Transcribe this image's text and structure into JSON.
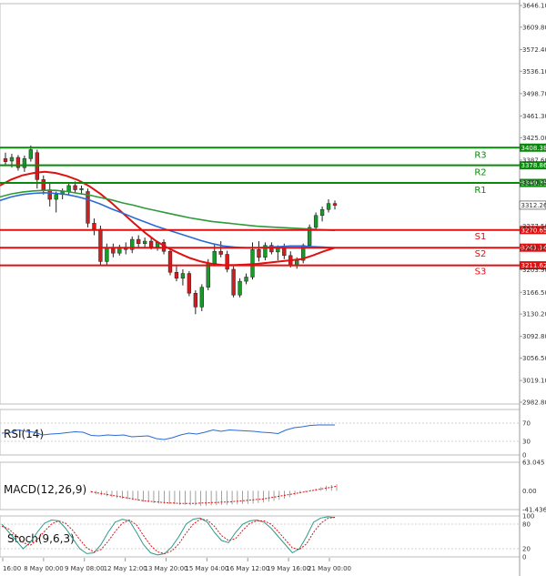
{
  "chart_data": {
    "type": "candlestick",
    "price_axis": {
      "ticks": [
        "3646.10",
        "3609.80",
        "3572.40",
        "3536.10",
        "3498.70",
        "3461.30",
        "3425.00",
        "3387.60",
        "3350.25",
        "3312.26",
        "3277.50",
        "3241.14",
        "3203.90",
        "3166.50",
        "3130.20",
        "3092.80",
        "3056.50",
        "3019.10",
        "2982.80"
      ],
      "ylim": [
        2982.8,
        3646.1
      ]
    },
    "time_axis": {
      "labels": [
        "16:00",
        "8 May 00:00",
        "9 May 08:00",
        "12 May 12:00",
        "13 May 20:00",
        "15 May 04:00",
        "16 May 12:00",
        "19 May 16:00",
        "21 May 00:00"
      ]
    },
    "current_price": "3312.26",
    "levels": [
      {
        "name": "R3",
        "value": 3408.38,
        "label": "3408.38",
        "color": "#0a8a0a"
      },
      {
        "name": "R2",
        "value": 3378.86,
        "label": "3378.86",
        "color": "#0a8a0a"
      },
      {
        "name": "R1",
        "value": 3349.35,
        "label": "3349.35",
        "color": "#0a8a0a"
      },
      {
        "name": "S1",
        "value": 3270.65,
        "label": "3270.65",
        "color": "#e01010"
      },
      {
        "name": "S2",
        "value": 3241.14,
        "label": "3241.14",
        "color": "#e01010"
      },
      {
        "name": "S3",
        "value": 3211.62,
        "label": "3211.62",
        "color": "#e01010"
      }
    ],
    "candles": [
      {
        "o": 3390,
        "h": 3400,
        "l": 3380,
        "c": 3385
      },
      {
        "o": 3386,
        "h": 3398,
        "l": 3375,
        "c": 3392
      },
      {
        "o": 3392,
        "h": 3396,
        "l": 3370,
        "c": 3375
      },
      {
        "o": 3375,
        "h": 3395,
        "l": 3368,
        "c": 3390
      },
      {
        "o": 3390,
        "h": 3412,
        "l": 3385,
        "c": 3405
      },
      {
        "o": 3400,
        "h": 3405,
        "l": 3340,
        "c": 3355
      },
      {
        "o": 3355,
        "h": 3362,
        "l": 3330,
        "c": 3338
      },
      {
        "o": 3338,
        "h": 3350,
        "l": 3310,
        "c": 3322
      },
      {
        "o": 3322,
        "h": 3335,
        "l": 3300,
        "c": 3330
      },
      {
        "o": 3330,
        "h": 3340,
        "l": 3322,
        "c": 3335
      },
      {
        "o": 3335,
        "h": 3350,
        "l": 3328,
        "c": 3345
      },
      {
        "o": 3345,
        "h": 3352,
        "l": 3332,
        "c": 3338
      },
      {
        "o": 3338,
        "h": 3345,
        "l": 3330,
        "c": 3340
      },
      {
        "o": 3335,
        "h": 3340,
        "l": 3275,
        "c": 3282
      },
      {
        "o": 3282,
        "h": 3290,
        "l": 3262,
        "c": 3272
      },
      {
        "o": 3272,
        "h": 3278,
        "l": 3212,
        "c": 3218
      },
      {
        "o": 3218,
        "h": 3248,
        "l": 3212,
        "c": 3240
      },
      {
        "o": 3240,
        "h": 3248,
        "l": 3225,
        "c": 3232
      },
      {
        "o": 3232,
        "h": 3246,
        "l": 3228,
        "c": 3242
      },
      {
        "o": 3242,
        "h": 3250,
        "l": 3230,
        "c": 3238
      },
      {
        "o": 3238,
        "h": 3260,
        "l": 3232,
        "c": 3255
      },
      {
        "o": 3255,
        "h": 3262,
        "l": 3240,
        "c": 3248
      },
      {
        "o": 3248,
        "h": 3258,
        "l": 3240,
        "c": 3252
      },
      {
        "o": 3252,
        "h": 3258,
        "l": 3238,
        "c": 3242
      },
      {
        "o": 3242,
        "h": 3252,
        "l": 3236,
        "c": 3250
      },
      {
        "o": 3250,
        "h": 3255,
        "l": 3230,
        "c": 3235
      },
      {
        "o": 3235,
        "h": 3240,
        "l": 3195,
        "c": 3200
      },
      {
        "o": 3200,
        "h": 3212,
        "l": 3185,
        "c": 3190
      },
      {
        "o": 3190,
        "h": 3205,
        "l": 3178,
        "c": 3198
      },
      {
        "o": 3198,
        "h": 3202,
        "l": 3160,
        "c": 3165
      },
      {
        "o": 3165,
        "h": 3170,
        "l": 3130,
        "c": 3142
      },
      {
        "o": 3142,
        "h": 3180,
        "l": 3135,
        "c": 3175
      },
      {
        "o": 3175,
        "h": 3222,
        "l": 3170,
        "c": 3215
      },
      {
        "o": 3215,
        "h": 3248,
        "l": 3210,
        "c": 3235
      },
      {
        "o": 3235,
        "h": 3252,
        "l": 3225,
        "c": 3230
      },
      {
        "o": 3230,
        "h": 3236,
        "l": 3200,
        "c": 3205
      },
      {
        "o": 3205,
        "h": 3210,
        "l": 3158,
        "c": 3162
      },
      {
        "o": 3162,
        "h": 3190,
        "l": 3158,
        "c": 3185
      },
      {
        "o": 3185,
        "h": 3198,
        "l": 3180,
        "c": 3192
      },
      {
        "o": 3192,
        "h": 3250,
        "l": 3188,
        "c": 3238
      },
      {
        "o": 3238,
        "h": 3252,
        "l": 3218,
        "c": 3225
      },
      {
        "o": 3225,
        "h": 3250,
        "l": 3220,
        "c": 3245
      },
      {
        "o": 3245,
        "h": 3250,
        "l": 3230,
        "c": 3234
      },
      {
        "o": 3234,
        "h": 3245,
        "l": 3220,
        "c": 3240
      },
      {
        "o": 3240,
        "h": 3248,
        "l": 3222,
        "c": 3228
      },
      {
        "o": 3228,
        "h": 3235,
        "l": 3208,
        "c": 3212
      },
      {
        "o": 3212,
        "h": 3225,
        "l": 3206,
        "c": 3220
      },
      {
        "o": 3220,
        "h": 3248,
        "l": 3215,
        "c": 3245
      },
      {
        "o": 3245,
        "h": 3280,
        "l": 3240,
        "c": 3275
      },
      {
        "o": 3275,
        "h": 3300,
        "l": 3270,
        "c": 3295
      },
      {
        "o": 3295,
        "h": 3310,
        "l": 3285,
        "c": 3305
      },
      {
        "o": 3305,
        "h": 3322,
        "l": 3300,
        "c": 3315
      },
      {
        "o": 3315,
        "h": 3320,
        "l": 3305,
        "c": 3312
      }
    ],
    "overlays": [
      {
        "name": "sma_fast",
        "color": "#e01010",
        "values": [
          3345,
          3355,
          3362,
          3366,
          3368,
          3366,
          3361,
          3354,
          3344,
          3331,
          3316,
          3299,
          3282,
          3266,
          3252,
          3241,
          3232,
          3224,
          3218,
          3214,
          3212,
          3212,
          3213,
          3214,
          3216,
          3218,
          3220,
          3222,
          3228,
          3235,
          3241
        ]
      },
      {
        "name": "sma_mid",
        "color": "#2b6ad6",
        "values": [
          3320,
          3326,
          3330,
          3332,
          3333,
          3332,
          3330,
          3326,
          3321,
          3314,
          3306,
          3299,
          3291,
          3284,
          3277,
          3271,
          3265,
          3259,
          3253,
          3248,
          3244,
          3242,
          3241,
          3241,
          3242,
          3243,
          3244,
          3244,
          3243,
          3242,
          3241
        ]
      },
      {
        "name": "sma_slow",
        "color": "#2e9a3a",
        "values": [
          3326,
          3331,
          3334,
          3336,
          3337,
          3337,
          3335,
          3332,
          3329,
          3325,
          3321,
          3316,
          3312,
          3307,
          3303,
          3299,
          3295,
          3291,
          3288,
          3285,
          3283,
          3281,
          3279,
          3277,
          3276,
          3275,
          3274,
          3273,
          3272,
          3271,
          3270
        ]
      }
    ],
    "rsi": {
      "label": "RSI(14)",
      "ticks": [
        "70",
        "30",
        "0"
      ],
      "ylim": [
        0,
        100
      ],
      "color": "#2b6ad6",
      "values": [
        48,
        49,
        55,
        52,
        50,
        44,
        46,
        47,
        49,
        51,
        50,
        43,
        42,
        44,
        43,
        44,
        40,
        41,
        42,
        36,
        34,
        38,
        44,
        48,
        46,
        50,
        55,
        52,
        55,
        54,
        53,
        52,
        50,
        49,
        47,
        55,
        60,
        62,
        65,
        66,
        66,
        66
      ]
    },
    "macd": {
      "label": "MACD(12,26,9)",
      "ticks": [
        "63.045",
        "0.00",
        "-41.436"
      ],
      "ylim": [
        -41.436,
        63.045
      ],
      "signal_color": "#e01010",
      "hist_color": "#888888",
      "histogram": [
        -4,
        -8,
        -10,
        -12,
        -14,
        -16,
        -17,
        -18,
        -20,
        -22,
        -24,
        -25,
        -27,
        -28,
        -28,
        -29,
        -30,
        -31,
        -31,
        -32,
        -32,
        -33,
        -33,
        -32,
        -32,
        -31,
        -31,
        -30,
        -30,
        -29,
        -29,
        -28,
        -27,
        -26,
        -24,
        -22,
        -20,
        -17,
        -14,
        -10,
        -6,
        -2,
        2,
        5,
        8,
        11,
        13,
        14
      ],
      "signal": [
        -2,
        -4,
        -6,
        -8,
        -10,
        -12,
        -14,
        -16,
        -18,
        -20,
        -22,
        -23,
        -24,
        -25,
        -26,
        -27,
        -27,
        -28,
        -28,
        -28,
        -28,
        -27,
        -27,
        -26,
        -26,
        -25,
        -25,
        -24,
        -23,
        -22,
        -21,
        -20,
        -19,
        -18,
        -16,
        -14,
        -12,
        -10,
        -8,
        -6,
        -4,
        -2,
        0,
        2,
        4,
        6,
        8,
        10
      ]
    },
    "stoch": {
      "label": "Stoch(9,6,3)",
      "ticks": [
        "100",
        "80",
        "20",
        "0"
      ],
      "ylim": [
        0,
        100
      ],
      "k_color": "#2e9a8a",
      "d_color": "#e01010",
      "k": [
        80,
        60,
        40,
        20,
        35,
        60,
        82,
        90,
        88,
        70,
        45,
        20,
        8,
        10,
        30,
        60,
        85,
        92,
        88,
        60,
        30,
        10,
        5,
        8,
        25,
        50,
        80,
        92,
        95,
        85,
        60,
        40,
        35,
        60,
        80,
        88,
        90,
        85,
        70,
        50,
        30,
        10,
        20,
        50,
        85,
        95,
        98,
        96
      ],
      "d": [
        75,
        68,
        52,
        35,
        28,
        42,
        62,
        80,
        88,
        82,
        65,
        42,
        22,
        12,
        18,
        38,
        62,
        82,
        90,
        78,
        52,
        28,
        12,
        8,
        15,
        32,
        58,
        80,
        92,
        90,
        75,
        52,
        40,
        45,
        65,
        82,
        88,
        88,
        80,
        62,
        42,
        22,
        18,
        32,
        60,
        82,
        94,
        97
      ]
    }
  }
}
